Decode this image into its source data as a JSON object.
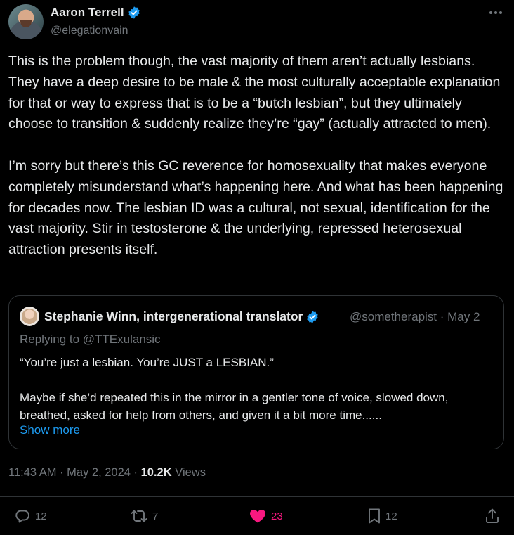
{
  "author": {
    "name": "Aaron Terrell",
    "handle": "@elegationvain"
  },
  "tweet": {
    "paragraphs": [
      "This is the problem though, the vast majority of them aren’t actually lesbians. They have a deep desire to be male & the most culturally acceptable explanation for that or way to express that is to be a “butch lesbian”, but they ultimately choose to transition & suddenly realize they’re “gay” (actually attracted to men).",
      "I’m sorry but there’s this GC reverence for homosexuality that makes everyone completely misunderstand what’s happening here. And what has been happening for decades now. The lesbian ID was a cultural, not sexual, identification for the vast majority. Stir in testosterone & the underlying, repressed heterosexual attraction presents itself."
    ]
  },
  "quote": {
    "name": "Stephanie Winn, intergenerational translator",
    "handle_date": "@sometherapist · May 2",
    "replying": "Replying to @TTExulansic",
    "paragraphs": [
      "“You’re just a lesbian. You’re JUST a LESBIAN.”",
      "Maybe if she’d repeated this in the mirror in a gentler tone of voice, slowed down, breathed, asked for help from others, and given it a bit more time......"
    ],
    "show_more": "Show more"
  },
  "meta": {
    "time_date": "11:43 AM · May 2, 2024 · ",
    "views_count": "10.2K",
    "views_label": " Views"
  },
  "actions": {
    "replies": "12",
    "reposts": "7",
    "likes": "23",
    "bookmarks": "12"
  },
  "colors": {
    "background": "#000000",
    "text": "#e7e9ea",
    "secondary": "#71767b",
    "link": "#1d9bf0",
    "like": "#f91880",
    "verified": "#1d9bf0"
  },
  "icons": [
    "verified-badge-icon",
    "more-icon",
    "reply-icon",
    "repost-icon",
    "heart-icon",
    "bookmark-icon",
    "share-icon"
  ]
}
